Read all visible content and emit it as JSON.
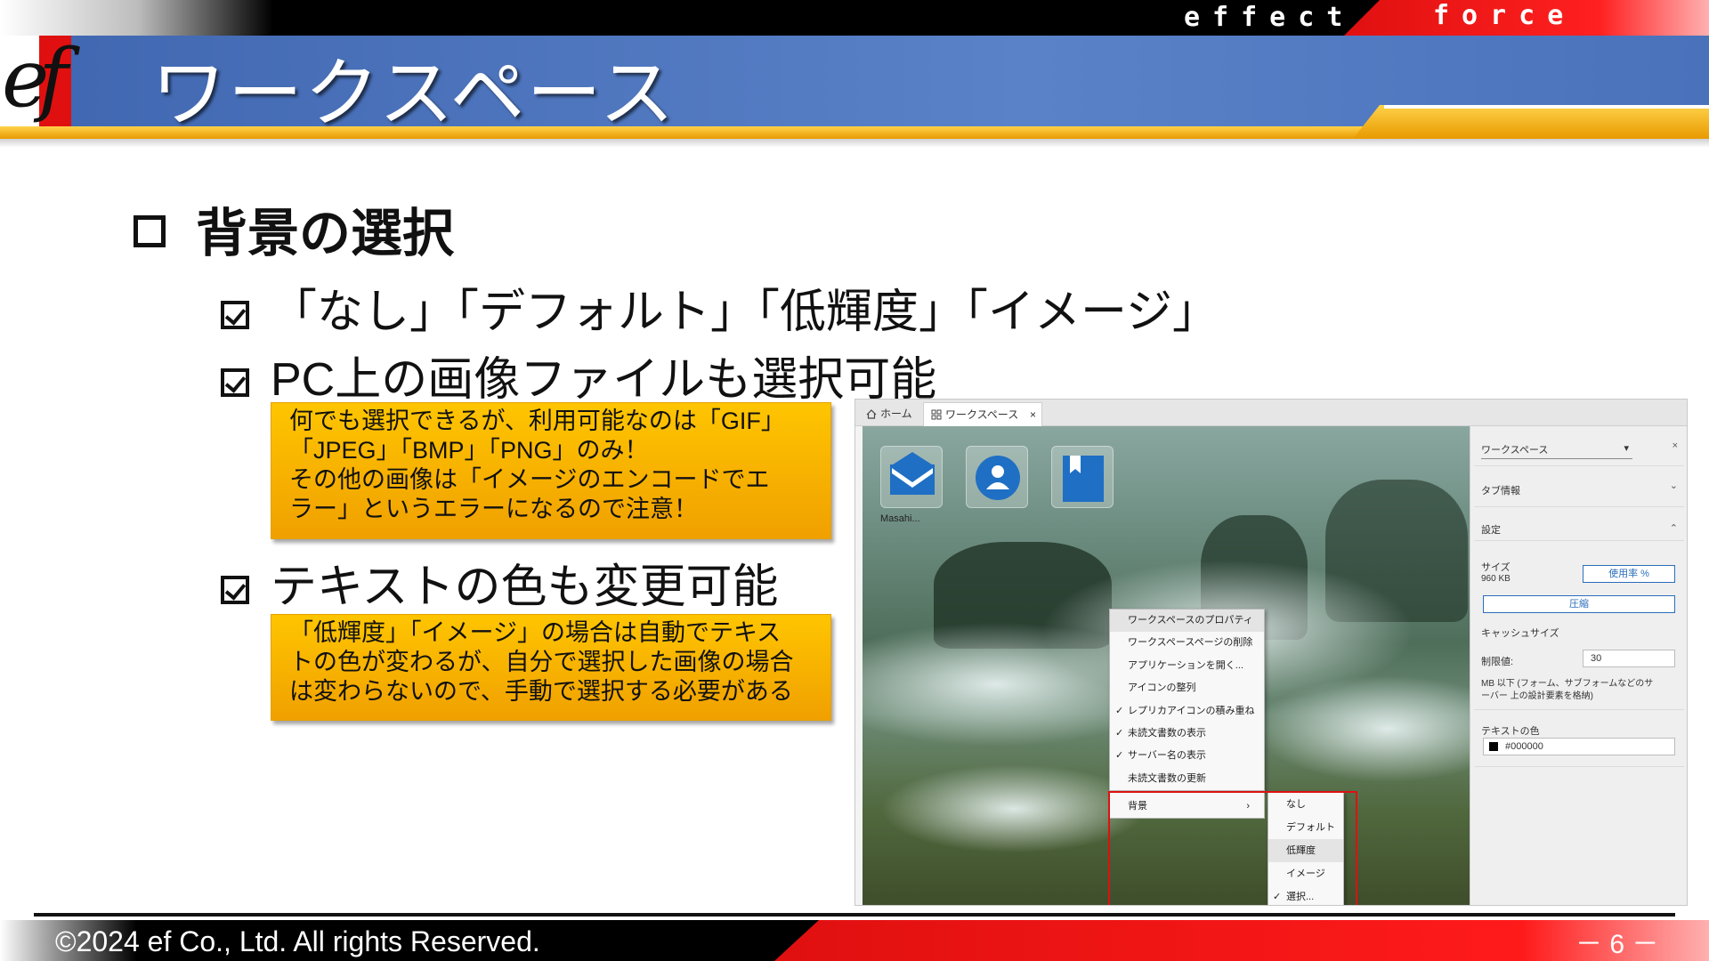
{
  "header": {
    "brand_left": "effect",
    "brand_right": "force",
    "logo": "ef",
    "title": "ワークスペース"
  },
  "section": {
    "heading": "背景の選択",
    "bullets": [
      "「なし」「デフォルト」「低輝度」「イメージ」",
      "PC上の画像ファイルも選択可能",
      "テキストの色も変更可能"
    ],
    "note1": [
      "何でも選択できるが、利用可能なのは「GIF」",
      "「JPEG」「BMP」「PNG」のみ！",
      "その他の画像は「イメージのエンコードでエ",
      "ラー」というエラーになるので注意！"
    ],
    "note2": [
      "「低輝度」「イメージ」の場合は自動でテキス",
      "トの色が変わるが、自分で選択した画像の場合",
      "は変わらないので、手動で選択する必要がある"
    ]
  },
  "screenshot": {
    "tabs": {
      "home": "ホーム",
      "workspace": "ワークスペース",
      "close": "×"
    },
    "app_label": "Masahi...",
    "app_icons": [
      "mail-icon",
      "user-icon",
      "bookmark-icon"
    ],
    "context_menu": [
      {
        "label": "ワークスペースのプロパティ",
        "checked": false
      },
      {
        "label": "ワークスペースページの削除",
        "checked": false
      },
      {
        "label": "アプリケーションを開く...",
        "checked": false
      },
      {
        "label": "アイコンの整列",
        "checked": false
      },
      {
        "label": "レプリカアイコンの積み重ね",
        "checked": true
      },
      {
        "label": "未読文書数の表示",
        "checked": true
      },
      {
        "label": "サーバー名の表示",
        "checked": true
      },
      {
        "label": "未読文書数の更新",
        "checked": false
      }
    ],
    "background_item": "背景",
    "background_arrow": "›",
    "submenu": [
      {
        "label": "なし",
        "checked": false
      },
      {
        "label": "デフォルト",
        "checked": false
      },
      {
        "label": "低輝度",
        "checked": false
      },
      {
        "label": "イメージ",
        "checked": false
      },
      {
        "label": "選択...",
        "checked": true
      }
    ],
    "panel": {
      "selector": "ワークスペース",
      "selector_arrow": "▾",
      "close": "×",
      "tab_info": "タブ情報",
      "settings": "設定",
      "size_label": "サイズ",
      "size_value": "960 KB",
      "usage_button": "使用率 %",
      "compress_button": "圧縮",
      "cache_size": "キャッシュサイズ",
      "limit_label": "制限値:",
      "limit_value": "30",
      "limit_note_1": "MB 以下 (フォーム、サブフォームなどのサ",
      "limit_note_2": "ーバー 上の設計要素を格納)",
      "text_color_label": "テキストの色",
      "text_color_value": "#000000",
      "chevron_down": "⌄",
      "chevron_up": "⌃"
    }
  },
  "footer": {
    "copyright": "©2024 ef Co., Ltd.  All rights Reserved.",
    "page": "－ 6 －"
  },
  "colors": {
    "header_blue": "#4a72bb",
    "accent_red": "#e01010",
    "gold": "#f0a000",
    "selection_frame": "#dd1111"
  }
}
